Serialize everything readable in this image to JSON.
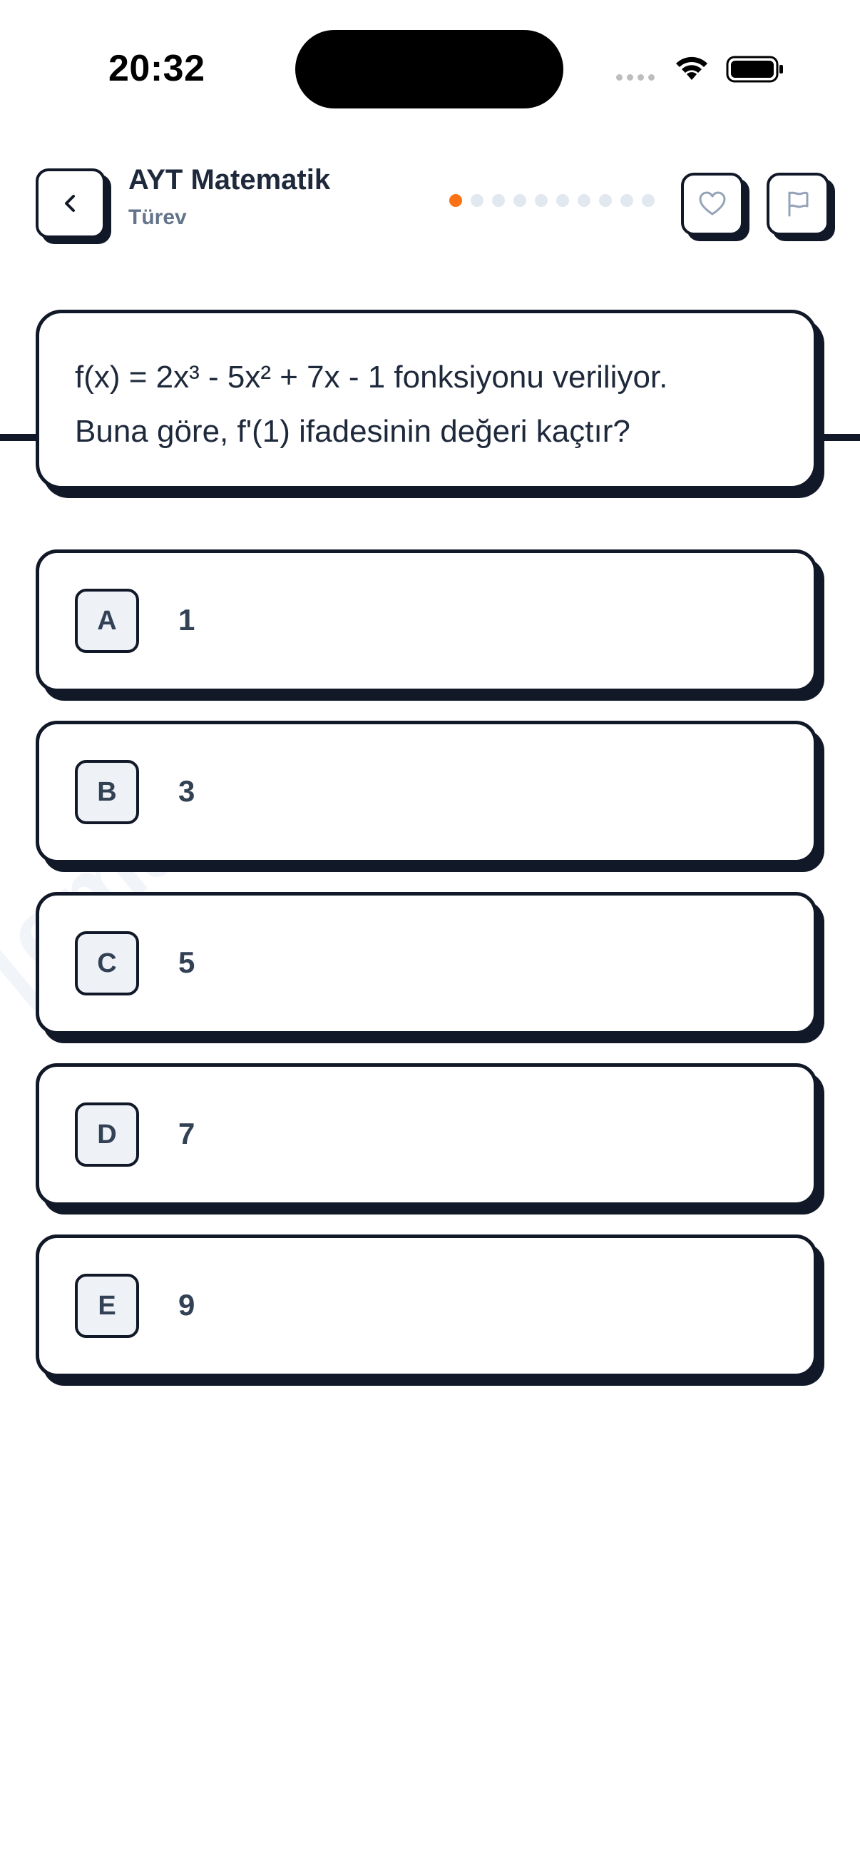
{
  "status_bar": {
    "time": "20:32"
  },
  "header": {
    "title": "AYT Matematik",
    "subtitle": "Türev",
    "progress": {
      "total": 10,
      "current": 1
    },
    "accent_color": "#f97316"
  },
  "question": {
    "line1": "f(x) = 2x³ - 5x² + 7x - 1 fonksiyonu veriliyor.",
    "line2": "Buna göre, f'(1) ifadesinin değeri kaçtır?"
  },
  "options": [
    {
      "letter": "A",
      "value": "1"
    },
    {
      "letter": "B",
      "value": "3"
    },
    {
      "letter": "C",
      "value": "5"
    },
    {
      "letter": "D",
      "value": "7"
    },
    {
      "letter": "E",
      "value": "9"
    }
  ],
  "watermark": "[email]"
}
